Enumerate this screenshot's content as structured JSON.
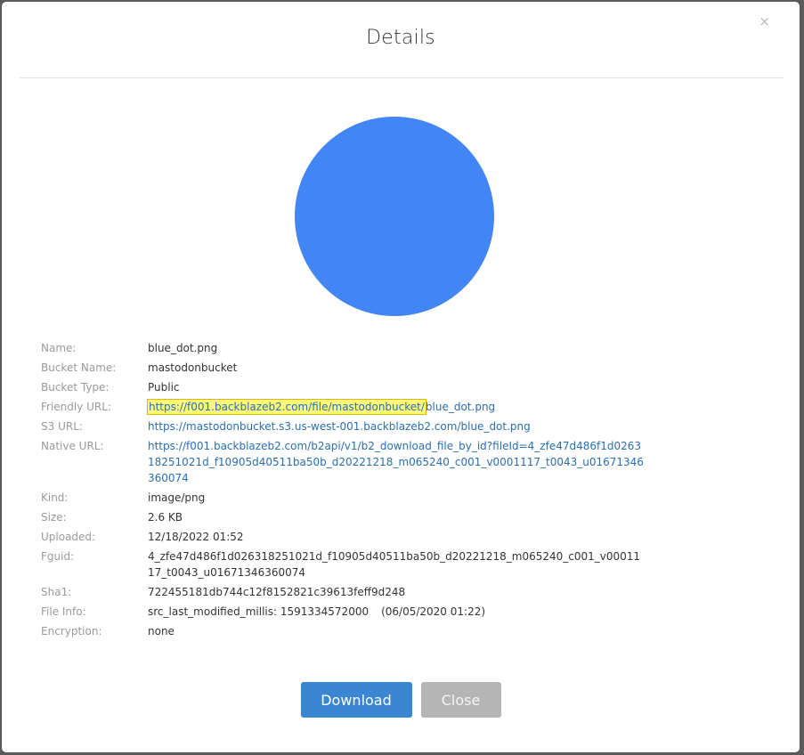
{
  "dialog": {
    "title": "Details",
    "close_glyph": "×",
    "close_icon": "close-icon"
  },
  "preview": {
    "file_name": "blue_dot.png",
    "fill_color": "#4285f4"
  },
  "details": {
    "name": {
      "label": "Name:",
      "value": "blue_dot.png"
    },
    "bucket_name": {
      "label": "Bucket Name:",
      "value": "mastodonbucket"
    },
    "bucket_type": {
      "label": "Bucket Type:",
      "value": "Public"
    },
    "friendly_url": {
      "label": "Friendly URL:",
      "value_highlighted": "https://f001.backblazeb2.com/file/mastodonbucket/",
      "value_rest": "blue_dot.png"
    },
    "s3_url": {
      "label": "S3 URL:",
      "value": "https://mastodonbucket.s3.us-west-001.backblazeb2.com/blue_dot.png"
    },
    "native_url": {
      "label": "Native URL:",
      "value": "https://f001.backblazeb2.com/b2api/v1/b2_download_file_by_id?fileId=4_zfe47d486f1d026318251021d_f10905d40511ba50b_d20221218_m065240_c001_v0001117_t0043_u01671346360074"
    },
    "kind": {
      "label": "Kind:",
      "value": "image/png"
    },
    "size": {
      "label": "Size:",
      "value": "2.6 KB"
    },
    "uploaded": {
      "label": "Uploaded:",
      "value": "12/18/2022 01:52"
    },
    "fguid": {
      "label": "Fguid:",
      "value": "4_zfe47d486f1d026318251021d_f10905d40511ba50b_d20221218_m065240_c001_v0001117_t0043_u01671346360074"
    },
    "sha1": {
      "label": "Sha1:",
      "value": "722455181db744c12f8152821c39613feff9d248"
    },
    "file_info": {
      "label": "File Info:",
      "value": "src_last_modified_millis: 1591334572000",
      "value_date": "(06/05/2020 01:22)"
    },
    "encryption": {
      "label": "Encryption:",
      "value": "none"
    }
  },
  "buttons": {
    "download_label": "Download",
    "close_label": "Close"
  },
  "colors": {
    "primary": "#3b86d3",
    "disabled": "#b5b5b5",
    "link": "#2a6fb0",
    "highlight": "#fcfb7a"
  }
}
